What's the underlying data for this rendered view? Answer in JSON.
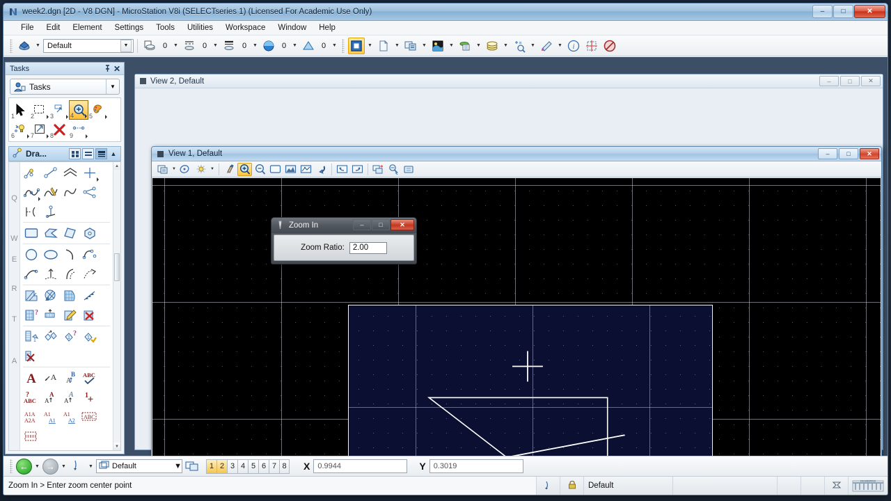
{
  "window": {
    "title": "week2.dgn [2D - V8 DGN] - MicroStation V8i (SELECTseries 1) (Licensed For Academic Use Only)",
    "app_icon": "microstation-icon",
    "minimize": "–",
    "maximize": "□",
    "close": "✕"
  },
  "menubar": {
    "items": [
      {
        "label": "File"
      },
      {
        "label": "Edit"
      },
      {
        "label": "Element"
      },
      {
        "label": "Settings"
      },
      {
        "label": "Tools"
      },
      {
        "label": "Utilities"
      },
      {
        "label": "Workspace"
      },
      {
        "label": "Window"
      },
      {
        "label": "Help"
      }
    ]
  },
  "toolbar": {
    "level_value": "Default",
    "color_value": "0",
    "style_value": "0",
    "weight_value": "0",
    "transparency_value": "0",
    "priority_value": "0",
    "icons": [
      "element-attributes-icon",
      "level-color-icon",
      "line-style-icon",
      "line-weight-icon",
      "transparency-icon",
      "priority-icon",
      "models-icon",
      "references-icon",
      "raster-manager-icon",
      "level-manager-icon",
      "level-display-icon",
      "element-selection-icon",
      "acs-icon",
      "element-info-icon",
      "snap-mode-icon",
      "no-snap-icon"
    ],
    "caret": "▼"
  },
  "tasks_panel": {
    "header_title": "Tasks",
    "pin_icon": "pin-icon",
    "close_icon": "close-icon",
    "combo_label": "Tasks",
    "combo_icon": "tasks-icon",
    "caret": "▼",
    "main_tools": [
      {
        "num": "1",
        "name": "element-selection-tool"
      },
      {
        "num": "2",
        "name": "fence-tool"
      },
      {
        "num": "3",
        "name": "manipulate-tool"
      },
      {
        "num": "4",
        "name": "zoom-tool",
        "selected": true
      },
      {
        "num": "5",
        "name": "change-attributes-tool"
      },
      {
        "num": "6",
        "name": "measure-tool"
      },
      {
        "num": "7",
        "name": "move-tool"
      },
      {
        "num": "8",
        "name": "delete-element-tool"
      },
      {
        "num": "9",
        "name": "dimension-tool"
      }
    ],
    "drawing_task": {
      "label": "Dra...",
      "icon": "drawing-task-icon",
      "view_modes": [
        "grid-view-icon",
        "list-view-icon",
        "table-view-icon"
      ],
      "collapse_icon": "chevron-up-icon"
    },
    "shortcut_keys": [
      "Q",
      "W",
      "E",
      "R",
      "T",
      "A"
    ],
    "tool_groups": [
      {
        "key": "Q",
        "tools": [
          "place-smartline-icon",
          "place-line-icon",
          "place-multiline-icon",
          "place-point-icon",
          "place-stream-curve-icon",
          "place-point-curve-icon",
          "place-bspline-icon",
          "construct-angle-bisector-icon",
          "place-line-at-active-angle-icon",
          "construct-minimum-distance-icon"
        ]
      },
      {
        "key": "W",
        "tools": [
          "place-block-icon",
          "place-shape-icon",
          "place-orthogonal-shape-icon",
          "place-regular-polygon-icon"
        ]
      },
      {
        "key": "E",
        "tools": [
          "place-circle-icon",
          "place-ellipse-icon",
          "place-arc-icon",
          "place-half-ellipse-icon",
          "place-quarter-ellipse-icon",
          "modify-arc-radius-icon",
          "modify-arc-angle-icon",
          "modify-arc-axis-icon"
        ]
      },
      {
        "key": "R",
        "tools": [
          "hatch-area-icon",
          "crosshatch-area-icon",
          "pattern-area-icon",
          "linear-pattern-icon",
          "show-pattern-attributes-icon",
          "match-pattern-attributes-icon",
          "change-pattern-icon",
          "delete-pattern-icon"
        ]
      },
      {
        "key": "T",
        "tools": [
          "place-cell-icon",
          "place-active-cell-matrix-icon",
          "identify-cell-icon",
          "replace-cell-icon",
          "drop-element-icon"
        ]
      },
      {
        "key": "A",
        "tools": [
          "place-text-icon",
          "place-note-icon",
          "place-text-above-icon",
          "spell-checker-icon",
          "match-text-attributes-icon",
          "change-text-attributes-icon",
          "edit-text-icon",
          "display-text-attributes-icon",
          "copy-enter-data-field-icon",
          "auto-fill-enter-data-field-icon",
          "copy-increment-text-icon",
          "fill-in-single-enter-data-field-icon",
          "copy-increment-enter-data-field-icon"
        ]
      }
    ],
    "scroll": {
      "up": "▲",
      "down": "▼"
    }
  },
  "view2": {
    "title": "View 2, Default",
    "minimize": "–",
    "maximize": "□",
    "close": "✕"
  },
  "view1": {
    "title": "View 1, Default",
    "minimize": "–",
    "maximize": "□",
    "close": "✕",
    "toolbar_icons": [
      "view-attributes-icon",
      "view-previous-icon",
      "view-display-mode-icon",
      "update-view-icon",
      "zoom-in-icon",
      "zoom-out-icon",
      "window-area-icon",
      "fit-view-icon",
      "rotate-view-icon",
      "pan-view-icon",
      "view-previous-nav-icon",
      "view-next-nav-icon",
      "copy-view-icon",
      "clip-volume-icon",
      "clip-mask-icon"
    ],
    "selected_tool": "zoom-in-icon",
    "caret": "▼"
  },
  "zoom_dialog": {
    "title": "Zoom In",
    "icon": "zoom-tool-icon",
    "ratio_label": "Zoom Ratio:",
    "ratio_value": "2.00",
    "minimize": "–",
    "maximize": "□",
    "close": "✕"
  },
  "bottom_bar": {
    "back_icon": "navigate-back-icon",
    "forward_icon": "navigate-forward-icon",
    "caret": "▼",
    "pointer_icon": "select-pointer-icon",
    "model_icon": "model-icon",
    "model_value": "Default",
    "window_icon": "window-arrange-icon",
    "view_numbers": [
      {
        "label": "1",
        "active": true
      },
      {
        "label": "2",
        "active": true
      },
      {
        "label": "3",
        "active": false
      },
      {
        "label": "4",
        "active": false
      },
      {
        "label": "5",
        "active": false
      },
      {
        "label": "6",
        "active": false
      },
      {
        "label": "7",
        "active": false
      },
      {
        "label": "8",
        "active": false
      }
    ],
    "x_label": "X",
    "x_value": "0.9944",
    "y_label": "Y",
    "y_value": "0.3019"
  },
  "statusbar": {
    "message": "Zoom In > Enter zoom center point",
    "snap_icon": "snap-icon",
    "lock_icon": "lock-icon",
    "model_name": "Default",
    "pointer_icon": "element-icon",
    "logo": "bentley-logo"
  },
  "colors": {
    "canvas_bg": "#000000",
    "fence_fill": "#0b1033",
    "geometry_stroke": "#ffffff",
    "accent_selected": "#ffc94a",
    "title_blue": "#9dc0de",
    "close_red": "#c8311c"
  }
}
